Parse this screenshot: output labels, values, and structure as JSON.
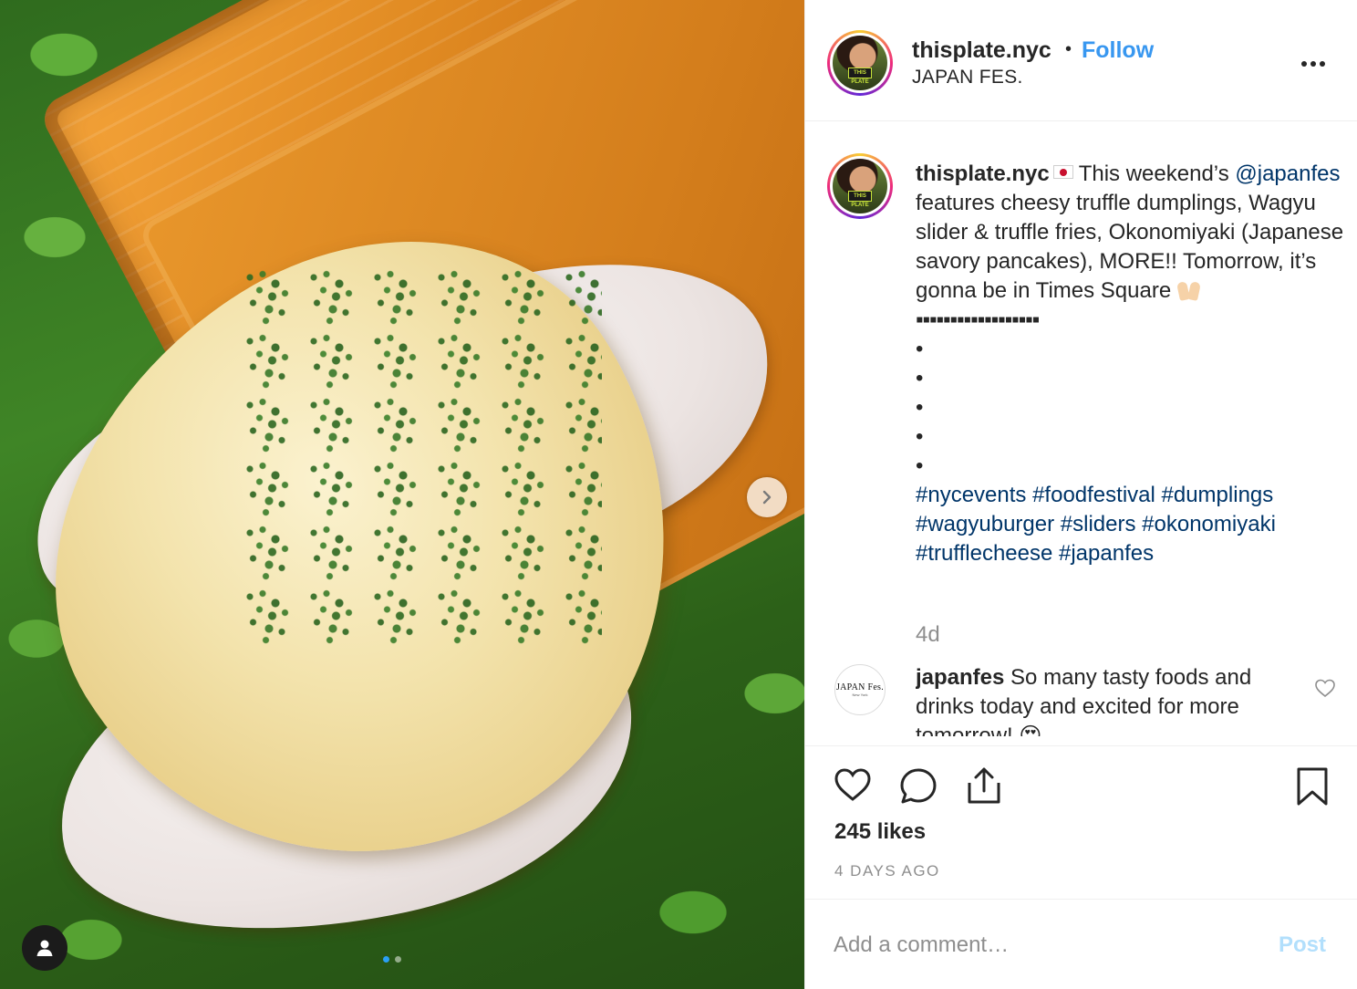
{
  "post": {
    "username": "thisplate.nyc",
    "separator": "•",
    "follow_label": "Follow",
    "location": "JAPAN FES.",
    "more_icon": "more-horizontal-icon"
  },
  "caption": {
    "username": "thisplate.nyc",
    "flag_icon": "japan-flag-emoji",
    "text_1": "This weekend’s",
    "mention": "@japanfes",
    "text_2": "features cheesy truffle dumplings, Wagyu slider & truffle fries, Okonomiyaki (Japanese savory pancakes), MORE!! Tomorrow, it’s gonna be in Times Square",
    "hands_icon": "raising-hands-emoji",
    "divider": "▪▪▪▪▪▪▪▪▪▪▪▪▪▪▪▪▪▪",
    "bullets": [
      "•",
      "•",
      "•",
      "•",
      "•"
    ],
    "hashtags": [
      "#nycevents",
      "#foodfestival",
      "#dumplings",
      "#wagyuburger",
      "#sliders",
      "#okonomiyaki",
      "#trufflecheese",
      "#japanfes"
    ],
    "age": "4d"
  },
  "comment": {
    "avatar_text": "JAPAN Fes.",
    "avatar_subtext": "New York",
    "username": "japanfes",
    "text": "So many tasty foods and drinks today and excited for more tomorrow!",
    "emoji_icon": "heart-eyes-emoji",
    "like_icon": "heart-outline-icon"
  },
  "actions": {
    "like_icon": "heart-icon",
    "comment_icon": "comment-icon",
    "share_icon": "share-icon",
    "save_icon": "bookmark-icon",
    "likes": "245 likes",
    "timestamp": "4 DAYS AGO"
  },
  "add_comment": {
    "placeholder": "Add a comment…",
    "post_label": "Post"
  },
  "carousel": {
    "next_icon": "chevron-right-icon",
    "tag_icon": "user-tag-icon",
    "slide_count": 2,
    "active_slide": 1
  },
  "colors": {
    "link_blue": "#3897f0",
    "hashtag": "#003569",
    "muted": "#8e8e8e",
    "post_disabled": "#b2dffc"
  }
}
